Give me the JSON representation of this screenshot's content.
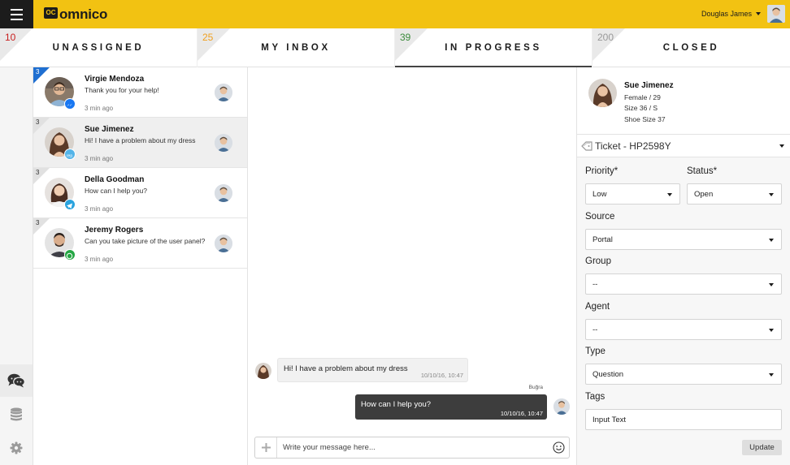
{
  "header": {
    "logo_mark": "OC",
    "logo_text": "omnico",
    "user_name": "Douglas James"
  },
  "tabs": [
    {
      "count": "10",
      "count_color": "#c81e1e",
      "label": "UNASSIGNED"
    },
    {
      "count": "25",
      "count_color": "#f0a020",
      "label": "MY INBOX"
    },
    {
      "count": "39",
      "count_color": "#3a8a3a",
      "label": "IN PROGRESS",
      "active": true
    },
    {
      "count": "200",
      "count_color": "#999999",
      "label": "CLOSED"
    }
  ],
  "rail": {
    "icons": [
      "chat-bubbles-icon",
      "database-icon",
      "settings-gear-icon"
    ]
  },
  "conversations": [
    {
      "badge": "3",
      "name": "Virgie Mendoza",
      "message": "Thank you for your help!",
      "time": "3 min ago",
      "channel": "messenger-icon",
      "channel_color": "#1877f2"
    },
    {
      "badge": "3",
      "name": "Sue Jimenez",
      "message": "Hi! I have a problem about my dress",
      "time": "3 min ago",
      "channel": "web-chat-icon",
      "channel_color": "#54b4e8"
    },
    {
      "badge": "3",
      "name": "Della Goodman",
      "message": "How can I help you?",
      "time": "3 min ago",
      "channel": "telegram-icon",
      "channel_color": "#2aa3de"
    },
    {
      "badge": "3",
      "name": "Jeremy Rogers",
      "message": "Can you take picture of the user panel?",
      "time": "3 min ago",
      "channel": "whatsapp-icon",
      "channel_color": "#25a744"
    }
  ],
  "chat": {
    "incoming": {
      "text": "Hi! I have a problem about my dress",
      "time": "10/10/16, 10:47"
    },
    "outgoing": {
      "author": "Buğra",
      "text": "How can I help you?",
      "time": "10/10/16, 10:47"
    },
    "composer_placeholder": "Write your message here..."
  },
  "profile": {
    "name": "Sue Jimenez",
    "gender_age": "Female / 29",
    "size": "Size 36 / S",
    "shoe_size": "Shoe Size 37"
  },
  "ticket": {
    "label": "Ticket - HP2598Y"
  },
  "form": {
    "priority_label": "Priority*",
    "priority_value": "Low",
    "status_label": "Status*",
    "status_value": "Open",
    "source_label": "Source",
    "source_value": "Portal",
    "group_label": "Group",
    "group_value": "--",
    "agent_label": "Agent",
    "agent_value": "--",
    "type_label": "Type",
    "type_value": "Question",
    "tags_label": "Tags",
    "tags_value": "Input Text",
    "update_label": "Update"
  },
  "colors": {
    "brand_yellow": "#f2c212",
    "dark": "#1c1c1c",
    "outgoing_bubble": "#3d3d3d",
    "unread_badge": "#1f6fd1"
  }
}
